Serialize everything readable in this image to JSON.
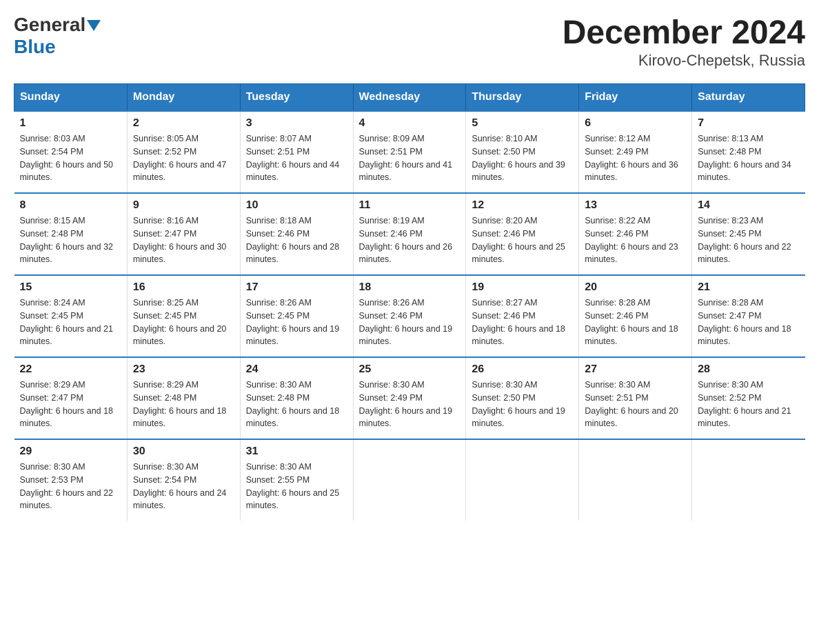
{
  "logo": {
    "general": "General",
    "blue": "Blue"
  },
  "title": "December 2024",
  "location": "Kirovo-Chepetsk, Russia",
  "days_of_week": [
    "Sunday",
    "Monday",
    "Tuesday",
    "Wednesday",
    "Thursday",
    "Friday",
    "Saturday"
  ],
  "weeks": [
    [
      {
        "day": "1",
        "sunrise": "Sunrise: 8:03 AM",
        "sunset": "Sunset: 2:54 PM",
        "daylight": "Daylight: 6 hours and 50 minutes."
      },
      {
        "day": "2",
        "sunrise": "Sunrise: 8:05 AM",
        "sunset": "Sunset: 2:52 PM",
        "daylight": "Daylight: 6 hours and 47 minutes."
      },
      {
        "day": "3",
        "sunrise": "Sunrise: 8:07 AM",
        "sunset": "Sunset: 2:51 PM",
        "daylight": "Daylight: 6 hours and 44 minutes."
      },
      {
        "day": "4",
        "sunrise": "Sunrise: 8:09 AM",
        "sunset": "Sunset: 2:51 PM",
        "daylight": "Daylight: 6 hours and 41 minutes."
      },
      {
        "day": "5",
        "sunrise": "Sunrise: 8:10 AM",
        "sunset": "Sunset: 2:50 PM",
        "daylight": "Daylight: 6 hours and 39 minutes."
      },
      {
        "day": "6",
        "sunrise": "Sunrise: 8:12 AM",
        "sunset": "Sunset: 2:49 PM",
        "daylight": "Daylight: 6 hours and 36 minutes."
      },
      {
        "day": "7",
        "sunrise": "Sunrise: 8:13 AM",
        "sunset": "Sunset: 2:48 PM",
        "daylight": "Daylight: 6 hours and 34 minutes."
      }
    ],
    [
      {
        "day": "8",
        "sunrise": "Sunrise: 8:15 AM",
        "sunset": "Sunset: 2:48 PM",
        "daylight": "Daylight: 6 hours and 32 minutes."
      },
      {
        "day": "9",
        "sunrise": "Sunrise: 8:16 AM",
        "sunset": "Sunset: 2:47 PM",
        "daylight": "Daylight: 6 hours and 30 minutes."
      },
      {
        "day": "10",
        "sunrise": "Sunrise: 8:18 AM",
        "sunset": "Sunset: 2:46 PM",
        "daylight": "Daylight: 6 hours and 28 minutes."
      },
      {
        "day": "11",
        "sunrise": "Sunrise: 8:19 AM",
        "sunset": "Sunset: 2:46 PM",
        "daylight": "Daylight: 6 hours and 26 minutes."
      },
      {
        "day": "12",
        "sunrise": "Sunrise: 8:20 AM",
        "sunset": "Sunset: 2:46 PM",
        "daylight": "Daylight: 6 hours and 25 minutes."
      },
      {
        "day": "13",
        "sunrise": "Sunrise: 8:22 AM",
        "sunset": "Sunset: 2:46 PM",
        "daylight": "Daylight: 6 hours and 23 minutes."
      },
      {
        "day": "14",
        "sunrise": "Sunrise: 8:23 AM",
        "sunset": "Sunset: 2:45 PM",
        "daylight": "Daylight: 6 hours and 22 minutes."
      }
    ],
    [
      {
        "day": "15",
        "sunrise": "Sunrise: 8:24 AM",
        "sunset": "Sunset: 2:45 PM",
        "daylight": "Daylight: 6 hours and 21 minutes."
      },
      {
        "day": "16",
        "sunrise": "Sunrise: 8:25 AM",
        "sunset": "Sunset: 2:45 PM",
        "daylight": "Daylight: 6 hours and 20 minutes."
      },
      {
        "day": "17",
        "sunrise": "Sunrise: 8:26 AM",
        "sunset": "Sunset: 2:45 PM",
        "daylight": "Daylight: 6 hours and 19 minutes."
      },
      {
        "day": "18",
        "sunrise": "Sunrise: 8:26 AM",
        "sunset": "Sunset: 2:46 PM",
        "daylight": "Daylight: 6 hours and 19 minutes."
      },
      {
        "day": "19",
        "sunrise": "Sunrise: 8:27 AM",
        "sunset": "Sunset: 2:46 PM",
        "daylight": "Daylight: 6 hours and 18 minutes."
      },
      {
        "day": "20",
        "sunrise": "Sunrise: 8:28 AM",
        "sunset": "Sunset: 2:46 PM",
        "daylight": "Daylight: 6 hours and 18 minutes."
      },
      {
        "day": "21",
        "sunrise": "Sunrise: 8:28 AM",
        "sunset": "Sunset: 2:47 PM",
        "daylight": "Daylight: 6 hours and 18 minutes."
      }
    ],
    [
      {
        "day": "22",
        "sunrise": "Sunrise: 8:29 AM",
        "sunset": "Sunset: 2:47 PM",
        "daylight": "Daylight: 6 hours and 18 minutes."
      },
      {
        "day": "23",
        "sunrise": "Sunrise: 8:29 AM",
        "sunset": "Sunset: 2:48 PM",
        "daylight": "Daylight: 6 hours and 18 minutes."
      },
      {
        "day": "24",
        "sunrise": "Sunrise: 8:30 AM",
        "sunset": "Sunset: 2:48 PM",
        "daylight": "Daylight: 6 hours and 18 minutes."
      },
      {
        "day": "25",
        "sunrise": "Sunrise: 8:30 AM",
        "sunset": "Sunset: 2:49 PM",
        "daylight": "Daylight: 6 hours and 19 minutes."
      },
      {
        "day": "26",
        "sunrise": "Sunrise: 8:30 AM",
        "sunset": "Sunset: 2:50 PM",
        "daylight": "Daylight: 6 hours and 19 minutes."
      },
      {
        "day": "27",
        "sunrise": "Sunrise: 8:30 AM",
        "sunset": "Sunset: 2:51 PM",
        "daylight": "Daylight: 6 hours and 20 minutes."
      },
      {
        "day": "28",
        "sunrise": "Sunrise: 8:30 AM",
        "sunset": "Sunset: 2:52 PM",
        "daylight": "Daylight: 6 hours and 21 minutes."
      }
    ],
    [
      {
        "day": "29",
        "sunrise": "Sunrise: 8:30 AM",
        "sunset": "Sunset: 2:53 PM",
        "daylight": "Daylight: 6 hours and 22 minutes."
      },
      {
        "day": "30",
        "sunrise": "Sunrise: 8:30 AM",
        "sunset": "Sunset: 2:54 PM",
        "daylight": "Daylight: 6 hours and 24 minutes."
      },
      {
        "day": "31",
        "sunrise": "Sunrise: 8:30 AM",
        "sunset": "Sunset: 2:55 PM",
        "daylight": "Daylight: 6 hours and 25 minutes."
      },
      null,
      null,
      null,
      null
    ]
  ]
}
